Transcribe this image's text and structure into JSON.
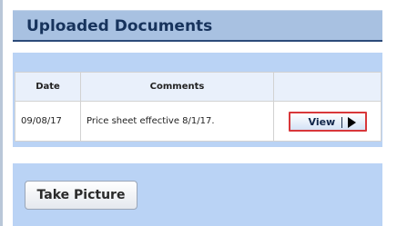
{
  "section": {
    "title": "Uploaded Documents"
  },
  "documents": {
    "columns": {
      "date": "Date",
      "comments": "Comments",
      "action": ""
    },
    "rows": [
      {
        "date": "09/08/17",
        "comment": "Price sheet effective 8/1/17.",
        "action_label": "View"
      }
    ]
  },
  "actions": {
    "take_picture_label": "Take Picture"
  },
  "icons": {
    "view_arrow": "play-icon"
  },
  "colors": {
    "header_bg": "#a8c1e1",
    "header_text": "#17335c",
    "panel_bg": "#bad3f5",
    "highlight_border": "#d8373a"
  }
}
